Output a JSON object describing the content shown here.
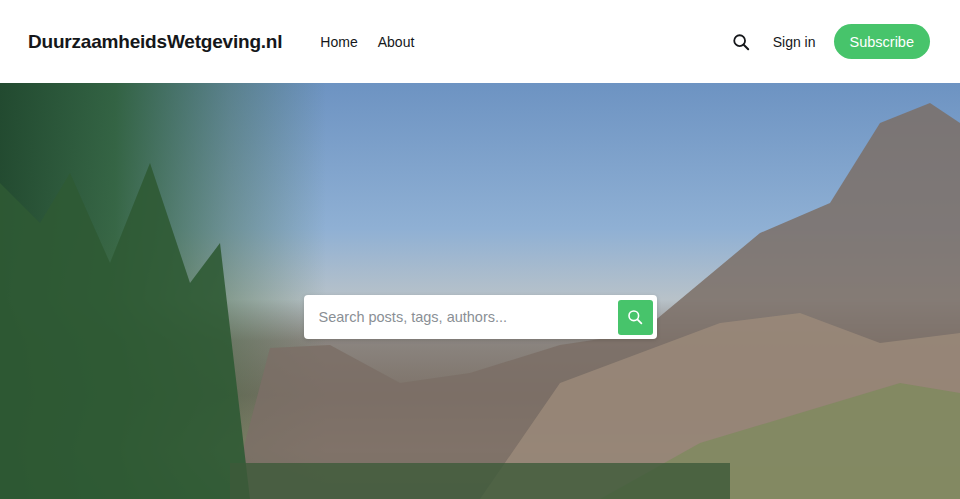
{
  "header": {
    "logo": "DuurzaamheidsWetgeving.nl",
    "nav": [
      {
        "label": "Home"
      },
      {
        "label": "About"
      }
    ],
    "sign_in": "Sign in",
    "subscribe": "Subscribe"
  },
  "hero": {
    "search": {
      "placeholder": "Search posts, tags, authors..."
    }
  }
}
